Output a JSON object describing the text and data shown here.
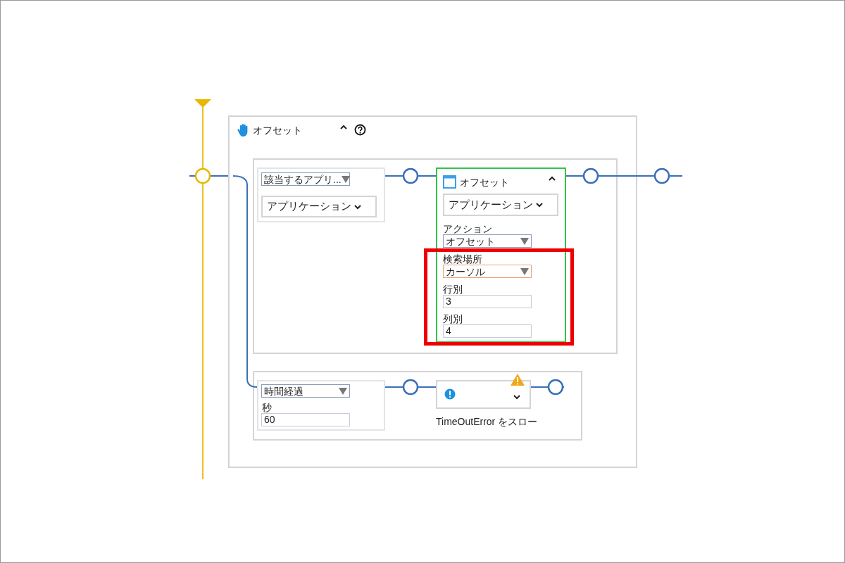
{
  "scope": {
    "title": "オフセット",
    "expanded": true
  },
  "find_app": {
    "dropdown": "該当するアプリ...",
    "app_button": "アプリケーション"
  },
  "action_card": {
    "title": "オフセット",
    "selected": true,
    "expanded": true,
    "app_button": "アプリケーション",
    "fields": [
      {
        "kind": "dropdown",
        "label": "アクション",
        "value": "オフセット",
        "focused": false
      },
      {
        "kind": "dropdown",
        "label": "検索場所",
        "value": "カーソル",
        "focused": true
      },
      {
        "kind": "input",
        "label": "行別",
        "value": "3",
        "focused": false
      },
      {
        "kind": "input",
        "label": "列別",
        "value": "4",
        "focused": false
      }
    ]
  },
  "highlight_frame": true,
  "timeout": {
    "dropdown": "時間経過",
    "label": "秒",
    "value": "60"
  },
  "throw_card": {
    "caption": "TimeOutError をスロー",
    "warning": true
  }
}
